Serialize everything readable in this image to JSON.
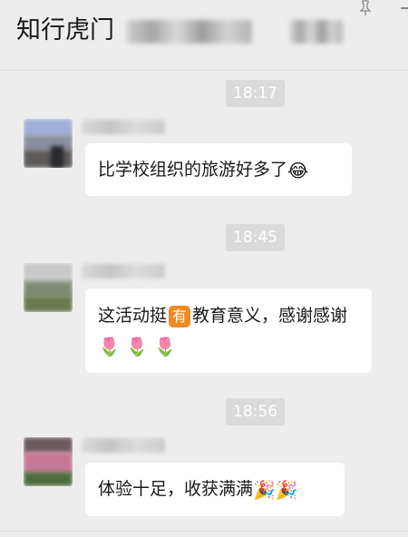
{
  "header": {
    "title": "知行虎门",
    "pin_icon": "pin-icon",
    "minimize_icon": "minimize-icon"
  },
  "messages": [
    {
      "time": "18:17",
      "text": "比学校组织的旅游好多了",
      "emoji": "😂"
    },
    {
      "time": "18:45",
      "text_a": "这活动挺",
      "badge": "有",
      "text_b": "教育意义，感谢感谢",
      "emojis": "🌷🌷🌷"
    },
    {
      "time": "18:56",
      "text": "体验十足，收获满满",
      "emojis": "🎉🎉"
    }
  ],
  "colors": {
    "background": "#ededed",
    "bubble": "#ffffff",
    "time_badge": "#dadada",
    "badge_orange": "#f08a24"
  }
}
